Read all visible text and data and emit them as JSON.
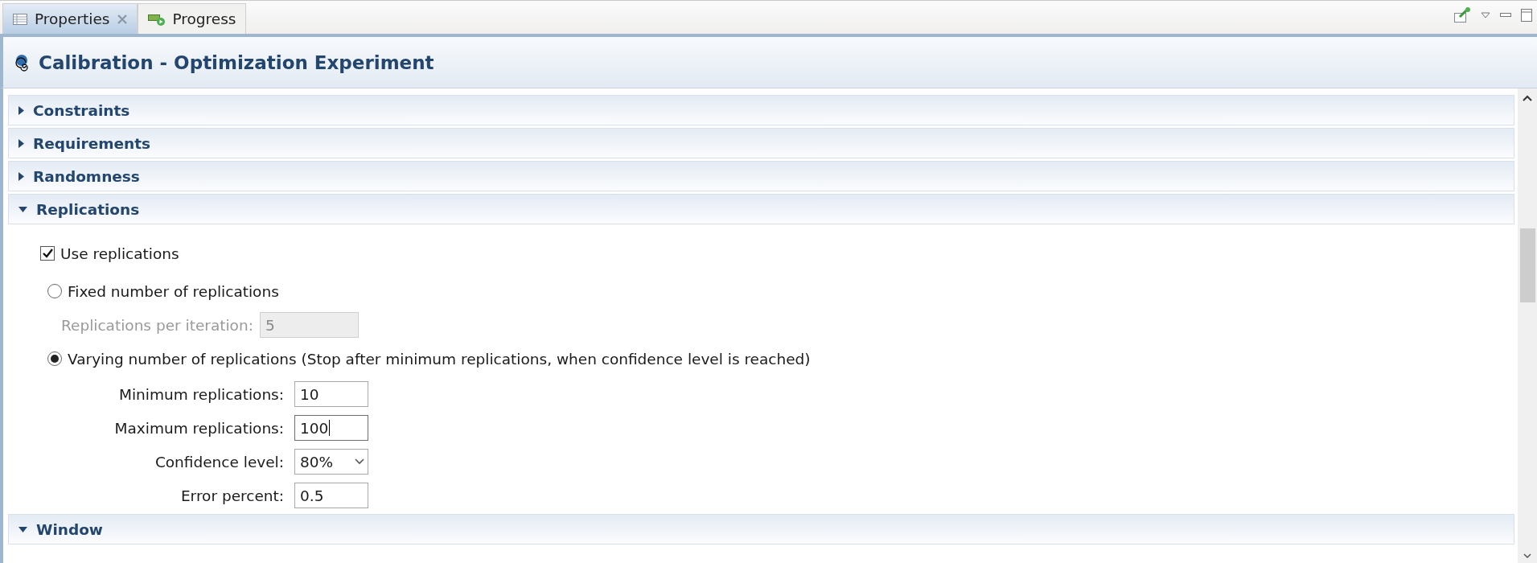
{
  "tabs": [
    {
      "label": "Properties",
      "selected": true,
      "closable": true
    },
    {
      "label": "Progress",
      "selected": false,
      "closable": false
    }
  ],
  "title": "Calibration - Optimization Experiment",
  "sections": [
    {
      "title": "Constraints",
      "expanded": false
    },
    {
      "title": "Requirements",
      "expanded": false
    },
    {
      "title": "Randomness",
      "expanded": false
    },
    {
      "title": "Replications",
      "expanded": true,
      "content": {
        "checkbox": {
          "label": "Use replications",
          "checked": true
        },
        "options": [
          {
            "label": "Fixed number of replications",
            "selected": false,
            "fields": [
              {
                "kind": "text",
                "label": "Replications per iteration:",
                "value": "5",
                "disabled": true,
                "focused": false
              }
            ]
          },
          {
            "label": "Varying number of replications (Stop after minimum replications, when confidence level is reached)",
            "selected": true,
            "fields": [
              {
                "kind": "text",
                "label": "Minimum replications:",
                "value": "10",
                "disabled": false,
                "focused": false
              },
              {
                "kind": "text",
                "label": "Maximum replications:",
                "value": "100",
                "disabled": false,
                "focused": true
              },
              {
                "kind": "combo",
                "label": "Confidence level:",
                "value": "80%",
                "disabled": false
              },
              {
                "kind": "text",
                "label": "Error percent:",
                "value": "0.5",
                "disabled": false,
                "focused": false
              }
            ]
          }
        ]
      }
    },
    {
      "title": "Window",
      "expanded": true
    }
  ]
}
